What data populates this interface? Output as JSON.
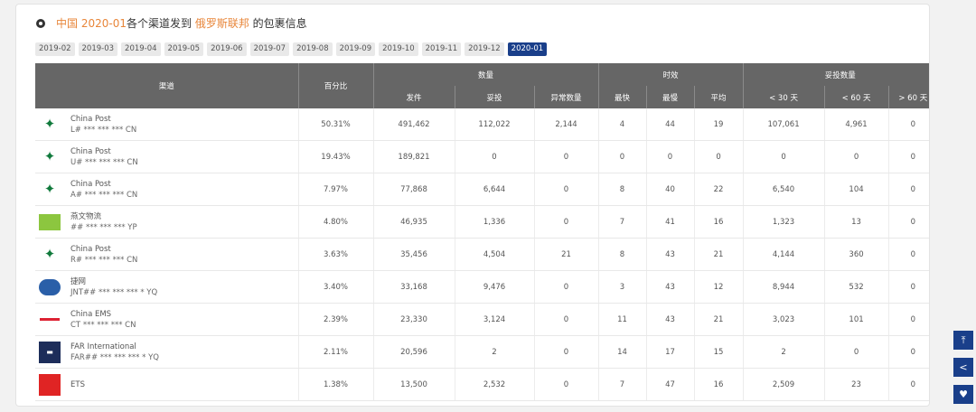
{
  "title": {
    "country": "中国",
    "period": "2020-01",
    "mid": "各个渠道发到",
    "dest": "俄罗斯联邦",
    "tail": "的包裹信息"
  },
  "tabs": [
    "2019-02",
    "2019-03",
    "2019-04",
    "2019-05",
    "2019-06",
    "2019-07",
    "2019-08",
    "2019-09",
    "2019-10",
    "2019-11",
    "2019-12",
    "2020-01"
  ],
  "active_tab": "2020-01",
  "headers": {
    "channel": "渠道",
    "percent": "百分比",
    "quantity": "数量",
    "timing": "时效",
    "delivered_count": "妥投数量",
    "sent": "发件",
    "delivered": "妥投",
    "abnormal": "异常数量",
    "fastest": "最快",
    "slowest": "最慢",
    "average": "平均",
    "lt30": "< 30 天",
    "lt60": "< 60 天",
    "gt60": "> 60 天"
  },
  "rows": [
    {
      "name": "China Post",
      "code": "L# *** *** *** CN",
      "logo": "china-post-logo",
      "percent": "50.31%",
      "sent": "491,462",
      "delivered": "112,022",
      "abnormal": "2,144",
      "fastest": "4",
      "slowest": "44",
      "average": "19",
      "lt30": "107,061",
      "lt60": "4,961",
      "gt60": "0"
    },
    {
      "name": "China Post",
      "code": "U# *** *** *** CN",
      "logo": "china-post-logo",
      "percent": "19.43%",
      "sent": "189,821",
      "delivered": "0",
      "abnormal": "0",
      "fastest": "0",
      "slowest": "0",
      "average": "0",
      "lt30": "0",
      "lt60": "0",
      "gt60": "0"
    },
    {
      "name": "China Post",
      "code": "A# *** *** *** CN",
      "logo": "china-post-logo",
      "percent": "7.97%",
      "sent": "77,868",
      "delivered": "6,644",
      "abnormal": "0",
      "fastest": "8",
      "slowest": "40",
      "average": "22",
      "lt30": "6,540",
      "lt60": "104",
      "gt60": "0"
    },
    {
      "name": "燕文物流",
      "code": "## *** *** *** YP",
      "logo": "yanwen-logo",
      "percent": "4.80%",
      "sent": "46,935",
      "delivered": "1,336",
      "abnormal": "0",
      "fastest": "7",
      "slowest": "41",
      "average": "16",
      "lt30": "1,323",
      "lt60": "13",
      "gt60": "0"
    },
    {
      "name": "China Post",
      "code": "R# *** *** *** CN",
      "logo": "china-post-logo",
      "percent": "3.63%",
      "sent": "35,456",
      "delivered": "4,504",
      "abnormal": "21",
      "fastest": "8",
      "slowest": "43",
      "average": "21",
      "lt30": "4,144",
      "lt60": "360",
      "gt60": "0"
    },
    {
      "name": "捷网",
      "code": "JNT## *** *** *** * YQ",
      "logo": "jnet-logo",
      "percent": "3.40%",
      "sent": "33,168",
      "delivered": "9,476",
      "abnormal": "0",
      "fastest": "3",
      "slowest": "43",
      "average": "12",
      "lt30": "8,944",
      "lt60": "532",
      "gt60": "0"
    },
    {
      "name": "China EMS",
      "code": "CT *** *** *** CN",
      "logo": "ems-logo",
      "percent": "2.39%",
      "sent": "23,330",
      "delivered": "3,124",
      "abnormal": "0",
      "fastest": "11",
      "slowest": "43",
      "average": "21",
      "lt30": "3,023",
      "lt60": "101",
      "gt60": "0"
    },
    {
      "name": "FAR International",
      "code": "FAR## *** *** *** * YQ",
      "logo": "far-logo",
      "percent": "2.11%",
      "sent": "20,596",
      "delivered": "2",
      "abnormal": "0",
      "fastest": "14",
      "slowest": "17",
      "average": "15",
      "lt30": "2",
      "lt60": "0",
      "gt60": "0"
    },
    {
      "name": "ETS",
      "code": "",
      "logo": "ets-logo",
      "percent": "1.38%",
      "sent": "13,500",
      "delivered": "2,532",
      "abnormal": "0",
      "fastest": "7",
      "slowest": "47",
      "average": "16",
      "lt30": "2,509",
      "lt60": "23",
      "gt60": "0"
    }
  ],
  "side_buttons": [
    "back-to-top-icon",
    "share-icon",
    "heart-icon"
  ],
  "colors": {
    "accent": "#1a3f8a",
    "highlight": "#e8863a",
    "header": "#666666"
  }
}
